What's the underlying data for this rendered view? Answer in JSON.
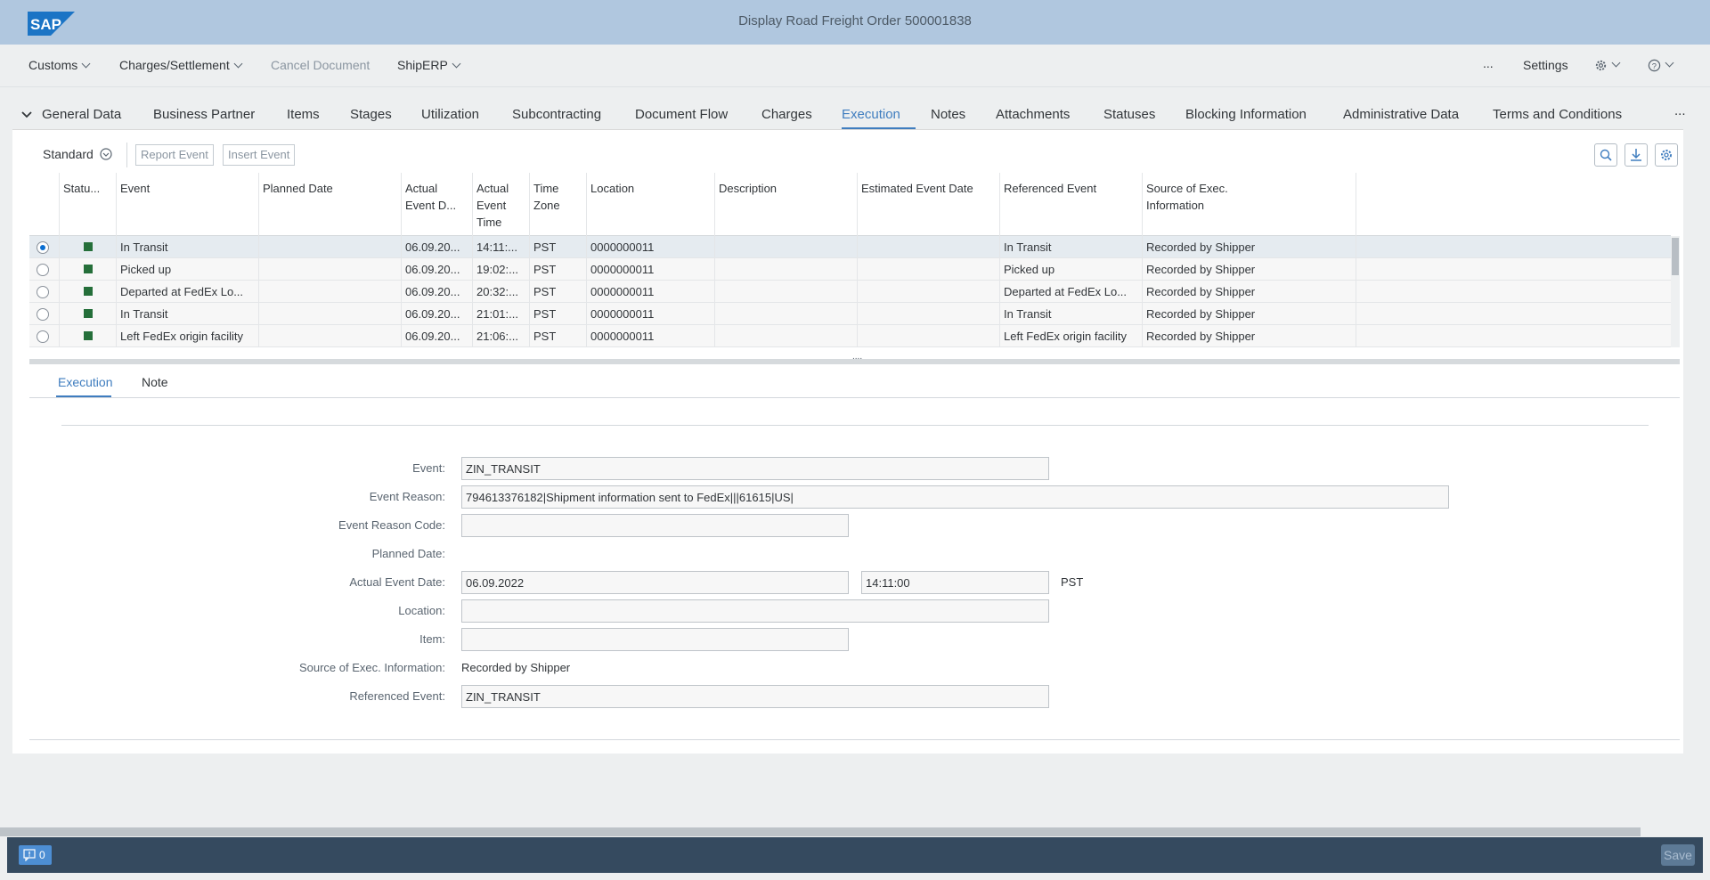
{
  "shell": {
    "logo_text": "SAP",
    "title": "Display Road Freight Order 500001838"
  },
  "toolbar": {
    "customs": "Customs",
    "charges_settlement": "Charges/Settlement",
    "cancel_document": "Cancel Document",
    "shiperp": "ShipERP",
    "more": "...",
    "settings": "Settings"
  },
  "tabs": [
    "General Data",
    "Business Partner",
    "Items",
    "Stages",
    "Utilization",
    "Subcontracting",
    "Document Flow",
    "Charges",
    "Execution",
    "Notes",
    "Attachments",
    "Statuses",
    "Blocking Information",
    "Administrative Data",
    "Terms and Conditions"
  ],
  "table_toolbar": {
    "variant": "Standard",
    "report_event": "Report Event",
    "insert_event": "Insert Event"
  },
  "grid": {
    "columns": {
      "status": "Statu...",
      "event": "Event",
      "planned_date": "Planned Date",
      "actual_event_date": "Actual Event D...",
      "actual_event_time": "Actual Event Time",
      "time_zone": "Time Zone",
      "location": "Location",
      "description": "Description",
      "estimated_event_date": "Estimated Event Date",
      "referenced_event": "Referenced Event",
      "source": "Source of Exec. Information"
    },
    "rows": [
      {
        "event": "In Transit",
        "planned": "",
        "date": "06.09.20...",
        "time": "14:11:...",
        "tz": "PST",
        "location": "0000000011",
        "description": "",
        "estimated": "",
        "referenced": "In Transit",
        "source": "Recorded by Shipper",
        "selected": true
      },
      {
        "event": "Picked up",
        "planned": "",
        "date": "06.09.20...",
        "time": "19:02:...",
        "tz": "PST",
        "location": "0000000011",
        "description": "",
        "estimated": "",
        "referenced": "Picked up",
        "source": "Recorded by Shipper",
        "selected": false
      },
      {
        "event": "Departed at FedEx Lo...",
        "planned": "",
        "date": "06.09.20...",
        "time": "20:32:...",
        "tz": "PST",
        "location": "0000000011",
        "description": "",
        "estimated": "",
        "referenced": "Departed at FedEx Lo...",
        "source": "Recorded by Shipper",
        "selected": false
      },
      {
        "event": "In Transit",
        "planned": "",
        "date": "06.09.20...",
        "time": "21:01:...",
        "tz": "PST",
        "location": "0000000011",
        "description": "",
        "estimated": "",
        "referenced": "In Transit",
        "source": "Recorded by Shipper",
        "selected": false
      },
      {
        "event": "Left FedEx origin facility",
        "planned": "",
        "date": "06.09.20...",
        "time": "21:06:...",
        "tz": "PST",
        "location": "0000000011",
        "description": "",
        "estimated": "",
        "referenced": "Left FedEx origin facility",
        "source": "Recorded by Shipper",
        "selected": false
      }
    ],
    "splitter": "...."
  },
  "subtabs": {
    "execution": "Execution",
    "note": "Note"
  },
  "form": {
    "event_label": "Event:",
    "event_value": "ZIN_TRANSIT",
    "reason_label": "Event Reason:",
    "reason_value": "794613376182|Shipment information sent to FedEx|||61615|US|",
    "reason_code_label": "Event Reason Code:",
    "reason_code_value": "",
    "planned_date_label": "Planned Date:",
    "actual_date_label": "Actual Event Date:",
    "actual_date_value": "06.09.2022",
    "actual_time_value": "14:11:00",
    "actual_tz": "PST",
    "location_label": "Location:",
    "location_value": "",
    "item_label": "Item:",
    "item_value": "",
    "source_label": "Source of Exec. Information:",
    "source_value": "Recorded by Shipper",
    "referenced_label": "Referenced Event:",
    "referenced_value": "ZIN_TRANSIT"
  },
  "footer": {
    "messages_count": "0",
    "save": "Save"
  },
  "colors": {
    "shell": "#b0c7df",
    "accent": "#3f7dbf",
    "status_green": "#256f3a",
    "footer": "#354a5f"
  }
}
